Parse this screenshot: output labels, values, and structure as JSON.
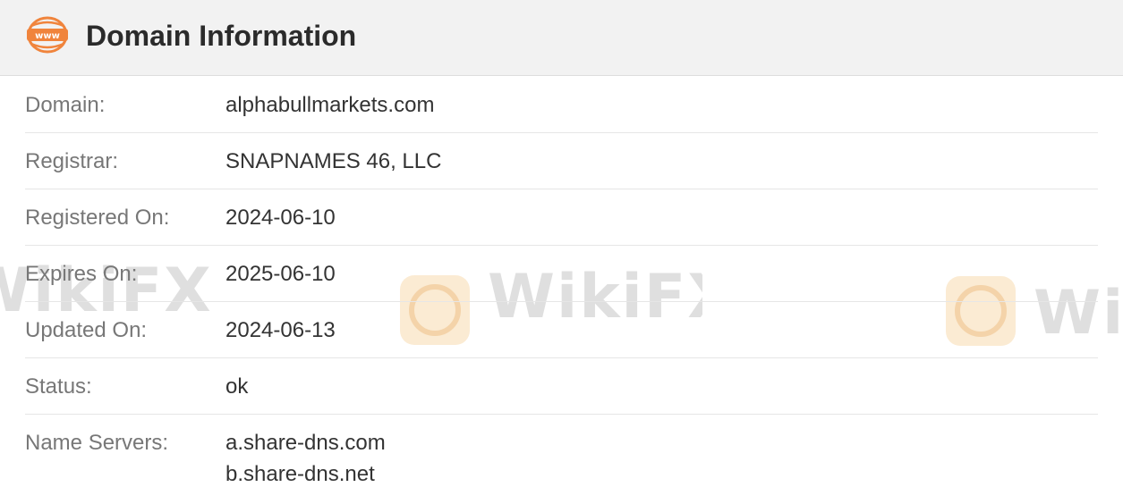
{
  "header": {
    "icon": "www-icon",
    "title": "Domain Information",
    "accent_color": "#f0843c"
  },
  "watermark": {
    "text": "WikiFX"
  },
  "rows": [
    {
      "label": "Domain:",
      "value": "alphabullmarkets.com"
    },
    {
      "label": "Registrar:",
      "value": "SNAPNAMES 46, LLC"
    },
    {
      "label": "Registered On:",
      "value": "2024-06-10"
    },
    {
      "label": "Expires On:",
      "value": "2025-06-10"
    },
    {
      "label": "Updated On:",
      "value": "2024-06-13"
    },
    {
      "label": "Status:",
      "value": "ok"
    },
    {
      "label": "Name Servers:",
      "values": [
        "a.share-dns.com",
        "b.share-dns.net"
      ]
    }
  ]
}
